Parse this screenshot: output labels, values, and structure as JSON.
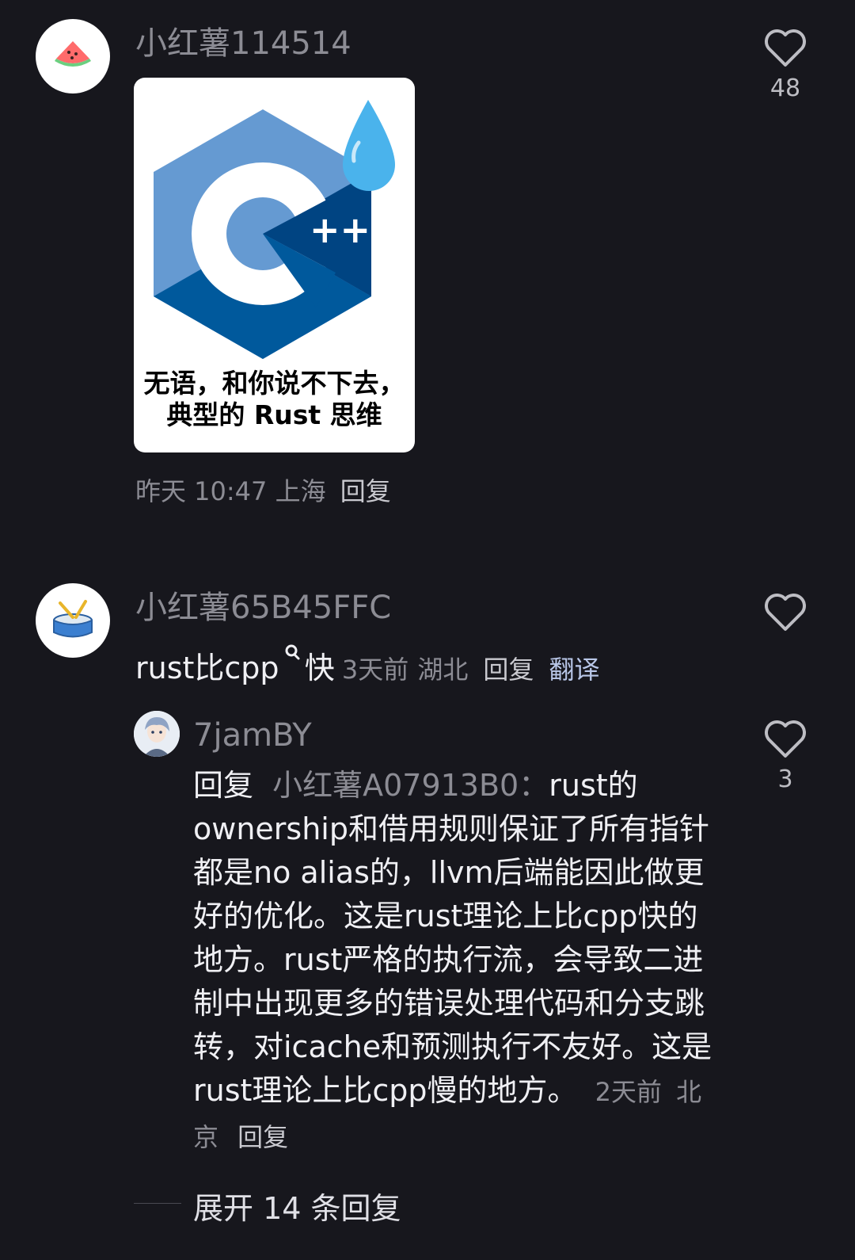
{
  "colors": {
    "background": "#17171d",
    "muted": "#8c8c94",
    "text": "#f0f0f4",
    "translate": "#b9c7e8"
  },
  "comments": [
    {
      "username": "小红薯114514",
      "avatar_icon": "watermelon-icon",
      "image": {
        "logo_icon": "cpp-logo-with-sweat-drop",
        "logo_text": "++",
        "caption_line1": "无语，和你说不下去，",
        "caption_line2": "典型的 Rust 思维"
      },
      "time": "昨天 10:47",
      "location": "上海",
      "reply_label": "回复",
      "likes": "48"
    },
    {
      "username": "小红薯65B45FFC",
      "avatar_icon": "drum-icon",
      "text_before": "rust比cpp",
      "search_icon": "search-icon",
      "text_after": "快",
      "time": "3天前",
      "location": "湖北",
      "reply_label": "回复",
      "translate_label": "翻译",
      "likes": "",
      "replies": [
        {
          "username": "7jamBY",
          "avatar_icon": "anime-avatar-icon",
          "reply_prefix": "回复",
          "mention": "小红薯A07913B0：",
          "text": "rust的ownership和借用规则保证了所有指针都是no alias的，llvm后端能因此做更好的优化。这是rust理论上比cpp快的地方。rust严格的执行流，会导致二进制中出现更多的错误处理代码和分支跳转，对icache和预测执行不友好。这是rust理论上比cpp慢的地方。",
          "time": "2天前",
          "location": "北京",
          "reply_label": "回复",
          "likes": "3"
        }
      ],
      "expand_label": "展开 14 条回复"
    }
  ]
}
